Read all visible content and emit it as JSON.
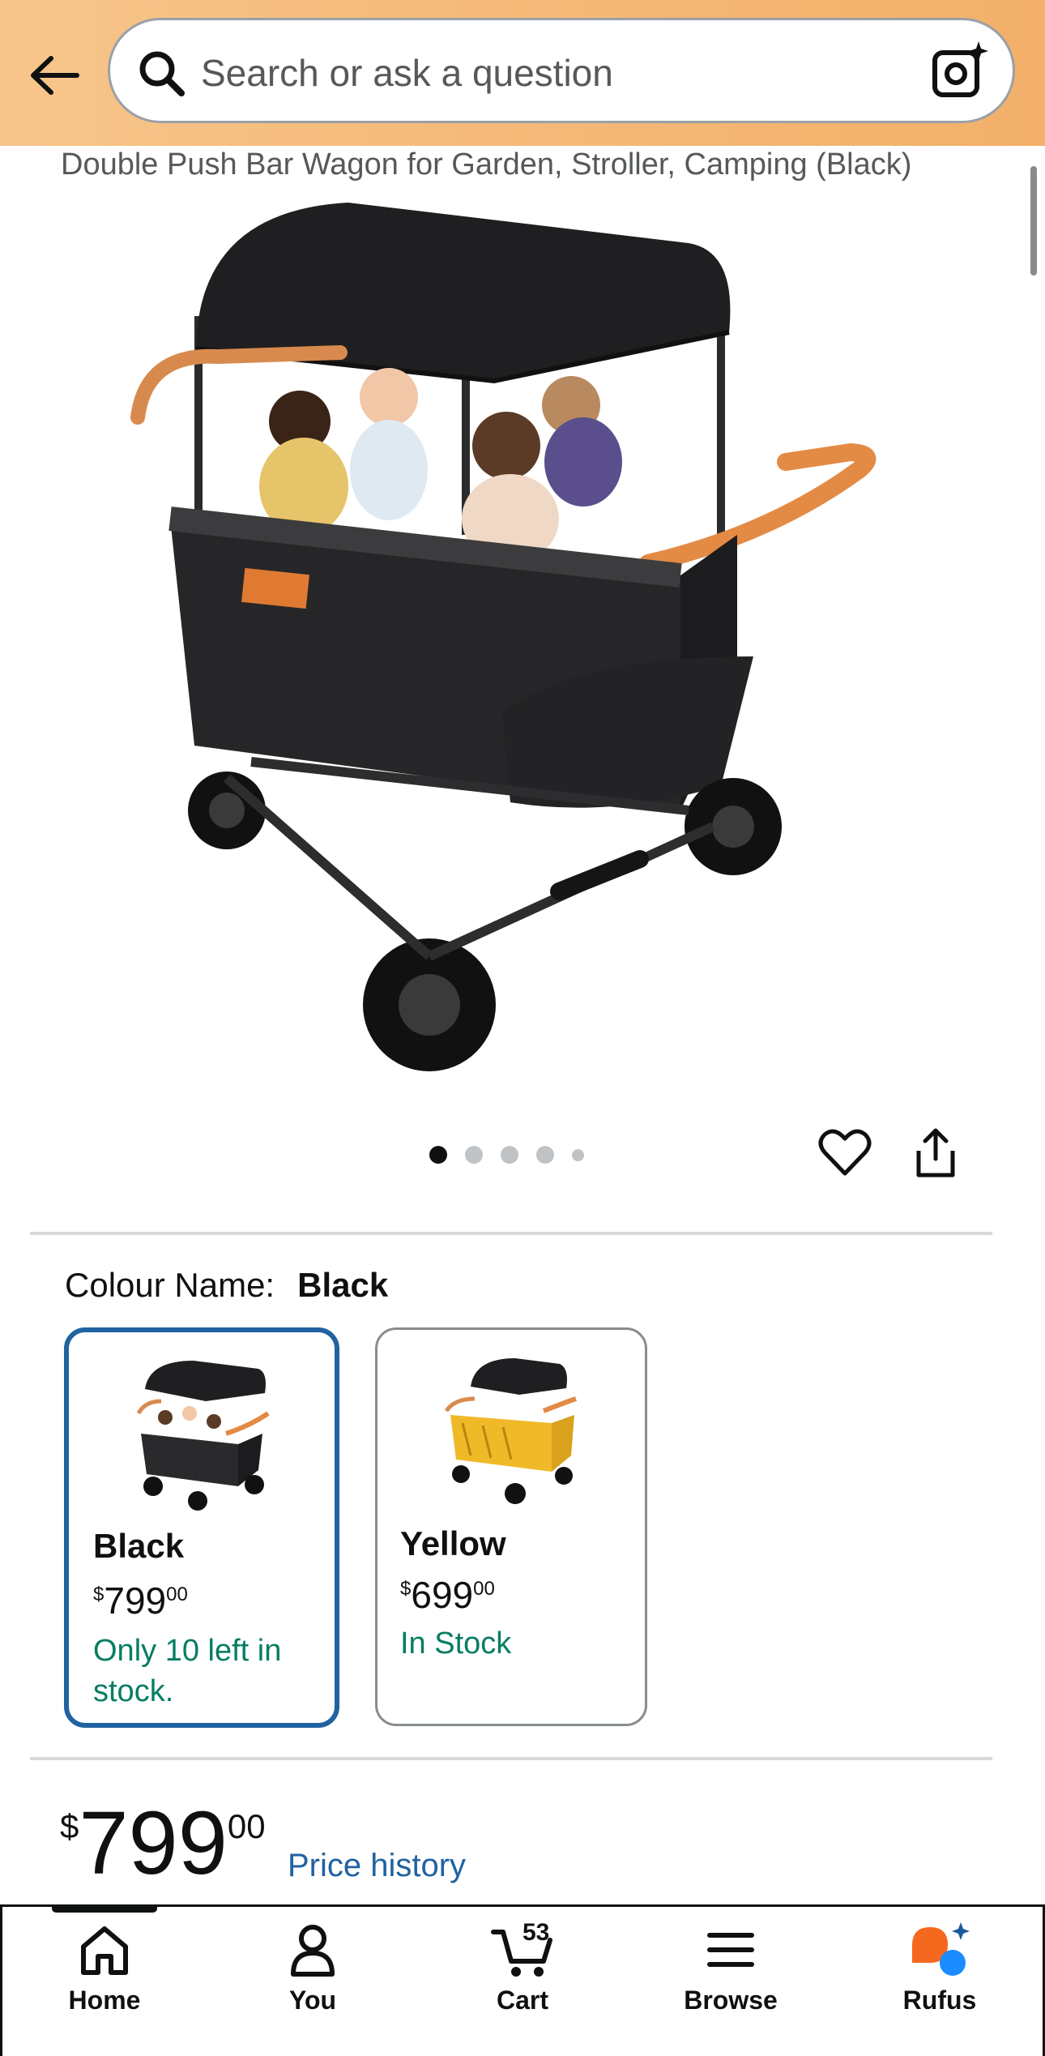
{
  "header": {
    "search_placeholder": "Search or ask a question"
  },
  "product": {
    "title_line": "Double Push Bar Wagon for Garden, Stroller, Camping (Black)",
    "image_count": 5,
    "active_image_index": 0
  },
  "colour": {
    "label": "Colour Name:",
    "selected": "Black",
    "options": [
      {
        "name": "Black",
        "currency": "$",
        "price_whole": "799",
        "price_fraction": "00",
        "stock": "Only 10 left in stock."
      },
      {
        "name": "Yellow",
        "currency": "$",
        "price_whole": "699",
        "price_fraction": "00",
        "stock": "In Stock"
      }
    ]
  },
  "price": {
    "currency": "$",
    "whole": "799",
    "fraction": "00",
    "history_link": "Price history"
  },
  "bottom_nav": {
    "items": [
      {
        "label": "Home",
        "icon": "home-icon"
      },
      {
        "label": "You",
        "icon": "person-icon"
      },
      {
        "label": "Cart",
        "icon": "cart-icon",
        "badge": "53"
      },
      {
        "label": "Browse",
        "icon": "menu-icon"
      },
      {
        "label": "Rufus",
        "icon": "rufus-icon"
      }
    ]
  },
  "colors": {
    "header_bg": "#f5b978",
    "link": "#2162a1",
    "in_stock": "#067d62",
    "selected_border": "#2162a1",
    "canopy_handle": "#e38a45"
  }
}
